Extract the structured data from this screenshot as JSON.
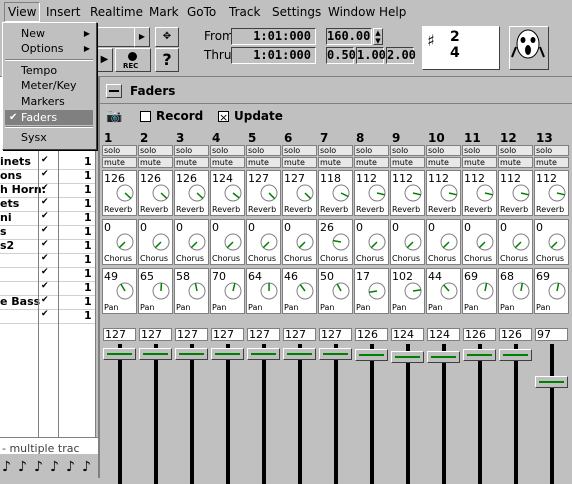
{
  "menubar": [
    "View",
    "Insert",
    "Realtime",
    "Mark",
    "GoTo",
    "Track",
    "Settings",
    "Window",
    "Help"
  ],
  "view_menu": {
    "items": [
      {
        "label": "New",
        "submenu": true
      },
      {
        "label": "Options",
        "submenu": true
      },
      {
        "label": "Tempo"
      },
      {
        "label": "Meter/Key"
      },
      {
        "label": "Markers"
      },
      {
        "label": "Faders",
        "checked": true
      },
      {
        "label": "Sysx"
      }
    ]
  },
  "transport": {
    "from_label": "From",
    "thru_label": "Thru",
    "from_value": "1:01:000",
    "thru_value": "1:01:000",
    "tempo": "160.00",
    "tempo_scale": [
      "0.50",
      "1.00",
      "2.00"
    ],
    "rec_label": "REC",
    "help_label": "?",
    "meter_top": "2",
    "meter_bottom": "4"
  },
  "tracks": [
    {
      "name": "inets",
      "check": "✔",
      "num": "1"
    },
    {
      "name": "ons",
      "check": "✔",
      "num": "1"
    },
    {
      "name": "h Horn:",
      "check": "✔",
      "num": "1"
    },
    {
      "name": "ets",
      "check": "✔",
      "num": "1"
    },
    {
      "name": "ni",
      "check": "✔",
      "num": "1"
    },
    {
      "name": "s",
      "check": "✔",
      "num": "1"
    },
    {
      "name": "s2",
      "check": "✔",
      "num": "1"
    },
    {
      "name": "",
      "check": "✔",
      "num": "1"
    },
    {
      "name": "",
      "check": "✔",
      "num": "1"
    },
    {
      "name": "",
      "check": "✔",
      "num": "1"
    },
    {
      "name": "e Bass",
      "check": "✔",
      "num": "1"
    },
    {
      "name": "",
      "check": "✔",
      "num": "1"
    }
  ],
  "bottom_left_text": "- multiple trac",
  "faders": {
    "title": "Faders",
    "record_label": "Record",
    "update_label": "Update",
    "record_checked": false,
    "update_checked": true,
    "channels": [
      {
        "num": "1",
        "reverb": "126",
        "chorus": "0",
        "pan": "49",
        "vol": "127"
      },
      {
        "num": "2",
        "reverb": "126",
        "chorus": "0",
        "pan": "65",
        "vol": "127"
      },
      {
        "num": "3",
        "reverb": "126",
        "chorus": "0",
        "pan": "58",
        "vol": "127"
      },
      {
        "num": "4",
        "reverb": "124",
        "chorus": "0",
        "pan": "70",
        "vol": "127"
      },
      {
        "num": "5",
        "reverb": "127",
        "chorus": "0",
        "pan": "64",
        "vol": "127"
      },
      {
        "num": "6",
        "reverb": "127",
        "chorus": "0",
        "pan": "46",
        "vol": "127"
      },
      {
        "num": "7",
        "reverb": "118",
        "chorus": "26",
        "pan": "50",
        "vol": "127"
      },
      {
        "num": "8",
        "reverb": "112",
        "chorus": "0",
        "pan": "17",
        "vol": "126"
      },
      {
        "num": "9",
        "reverb": "112",
        "chorus": "0",
        "pan": "102",
        "vol": "124"
      },
      {
        "num": "10",
        "reverb": "112",
        "chorus": "0",
        "pan": "44",
        "vol": "124"
      },
      {
        "num": "11",
        "reverb": "112",
        "chorus": "0",
        "pan": "69",
        "vol": "126"
      },
      {
        "num": "12",
        "reverb": "112",
        "chorus": "0",
        "pan": "68",
        "vol": "126"
      },
      {
        "num": "13",
        "reverb": "112",
        "chorus": "0",
        "pan": "69",
        "vol": "97"
      }
    ],
    "solo_label": "solo",
    "mute_label": "mute",
    "reverb_label": "Reverb",
    "chorus_label": "Chorus",
    "pan_label": "Pan"
  },
  "colors": {
    "accent": "#008000",
    "menu_bg": "#c0c0c0",
    "highlight": "#808080"
  }
}
